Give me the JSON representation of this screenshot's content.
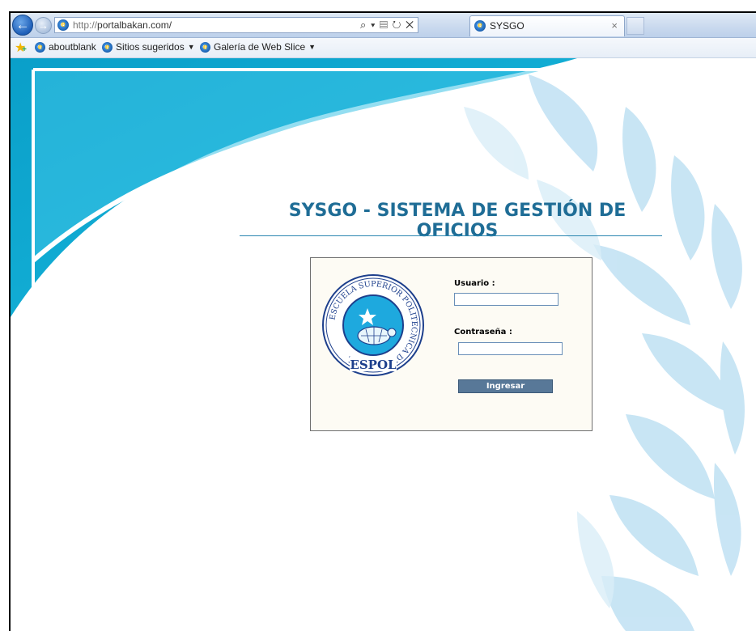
{
  "browser": {
    "url": "http://portalbakan.com/",
    "url_protocol": "http://",
    "url_host": "portalbakan.com/",
    "address_tools": "⌕ ▾ ▤ ↻ ✕",
    "tab_title": "SYSGO",
    "tab_close": "×",
    "back_glyph": "←",
    "forward_glyph": "→"
  },
  "favorites": {
    "items": [
      {
        "label": "aboutblank",
        "dropdown": false
      },
      {
        "label": "Sitios sugeridos",
        "dropdown": true
      },
      {
        "label": "Galería de Web Slice",
        "dropdown": true
      }
    ]
  },
  "page": {
    "title": "SYSGO - SISTEMA DE GESTIÓN DE OFICIOS",
    "login": {
      "username_label": "Usuario :",
      "username_value": "",
      "password_label": "Contraseña :",
      "password_value": "",
      "submit_label": "Ingresar"
    },
    "seal": {
      "ring_text": "ESCUELA SUPERIOR POLITECNICA DEL LITORAL",
      "name": "ESPOL"
    }
  },
  "colors": {
    "title": "#1f6d96",
    "button": "#587898",
    "wave": "#0aa5cf",
    "leaf": "#bfe1f3"
  },
  "icons": [
    "back-arrow-icon",
    "forward-arrow-icon",
    "ie-icon",
    "search-icon",
    "refresh-icon",
    "stop-icon",
    "favorites-star-icon",
    "espol-seal-icon"
  ]
}
